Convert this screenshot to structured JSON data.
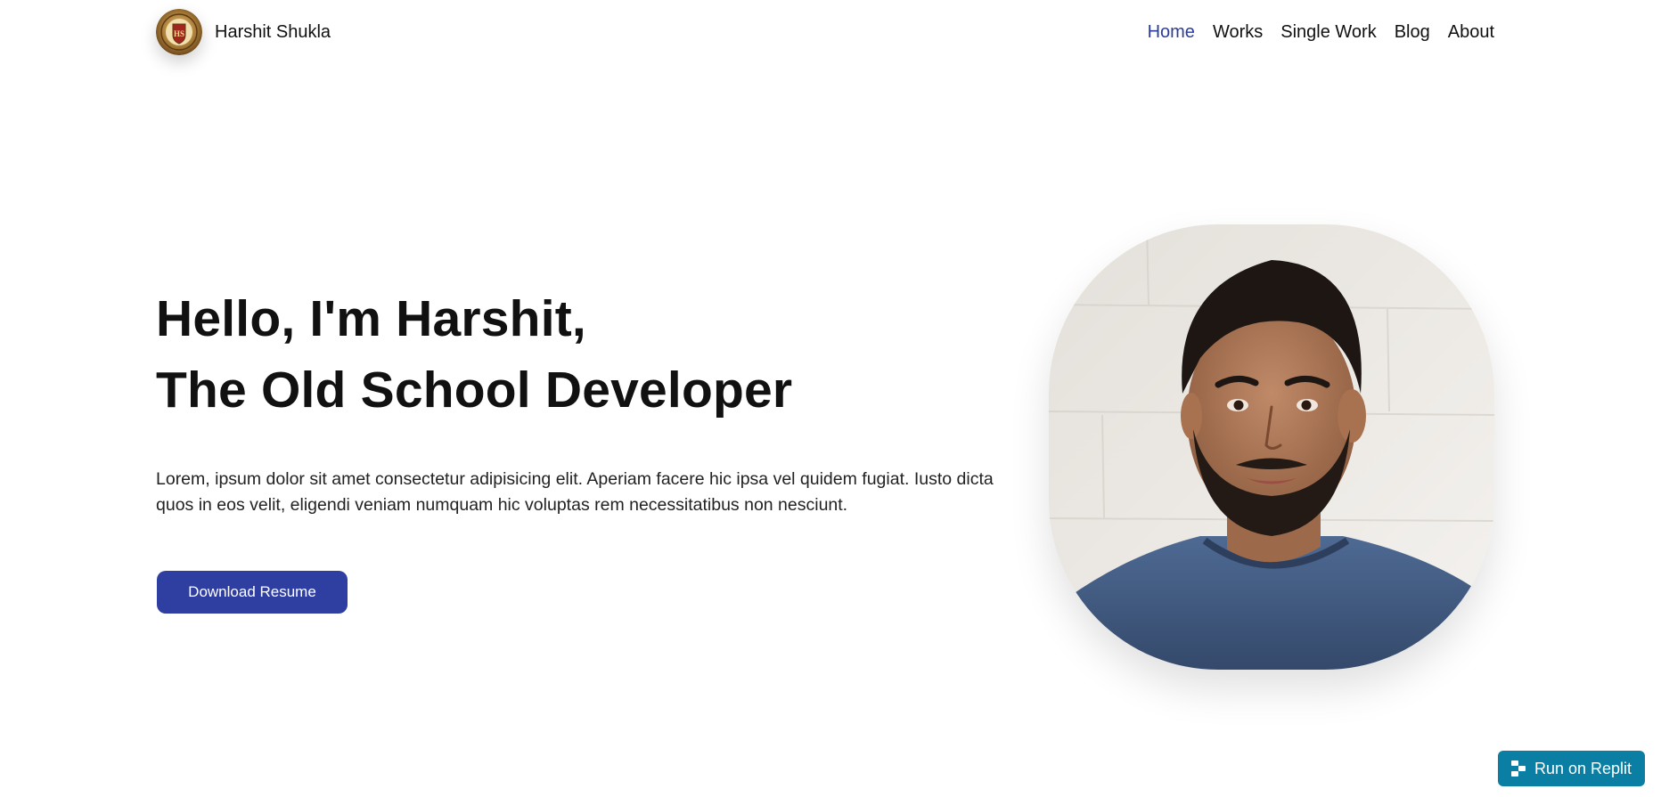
{
  "header": {
    "brand_name": "Harshit Shukla",
    "logo_icon": "hs-crest-logo",
    "nav": [
      {
        "label": "Home",
        "active": true
      },
      {
        "label": "Works",
        "active": false
      },
      {
        "label": "Single Work",
        "active": false
      },
      {
        "label": "Blog",
        "active": false
      },
      {
        "label": "About",
        "active": false
      }
    ]
  },
  "hero": {
    "title_line1": "Hello, I'm Harshit,",
    "title_line2": "The Old School Developer",
    "description": "Lorem, ipsum dolor sit amet consectetur adipisicing elit. Aperiam facere hic ipsa vel quidem fugiat. Iusto dicta quos in eos velit, eligendi veniam numquam hic voluptas rem necessitatibus non nesciunt.",
    "button_label": "Download Resume"
  },
  "portrait": {
    "subject": "bearded-man-blue-tshirt"
  },
  "replit": {
    "label": "Run on Replit",
    "icon": "replit-icon"
  },
  "colors": {
    "accent": "#2f3ea1",
    "nav_active": "#2d3c9b",
    "replit": "#0b7fa3",
    "text": "#111111"
  }
}
